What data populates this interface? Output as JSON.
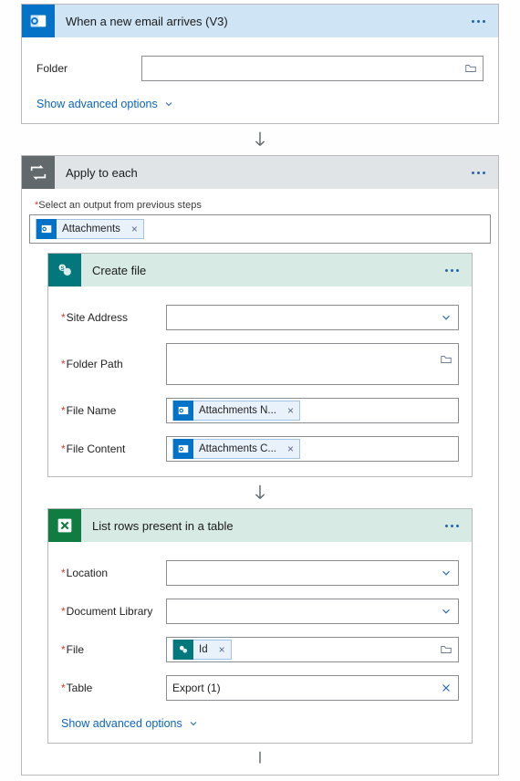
{
  "email": {
    "title": "When a new email arrives (V3)",
    "folder_label": "Folder",
    "adv": "Show advanced options"
  },
  "loop": {
    "title": "Apply to each",
    "select_label": "Select an output from previous steps",
    "token": "Attachments"
  },
  "createFile": {
    "title": "Create file",
    "siteAddress": "Site Address",
    "folderPath": "Folder Path",
    "fileName": "File Name",
    "fileContent": "File Content",
    "tokenName": "Attachments N...",
    "tokenContent": "Attachments C..."
  },
  "listRows": {
    "title": "List rows present in a table",
    "location": "Location",
    "docLib": "Document Library",
    "file": "File",
    "table": "Table",
    "tokenId": "Id",
    "tableValue": "Export (1)",
    "adv": "Show advanced options"
  }
}
